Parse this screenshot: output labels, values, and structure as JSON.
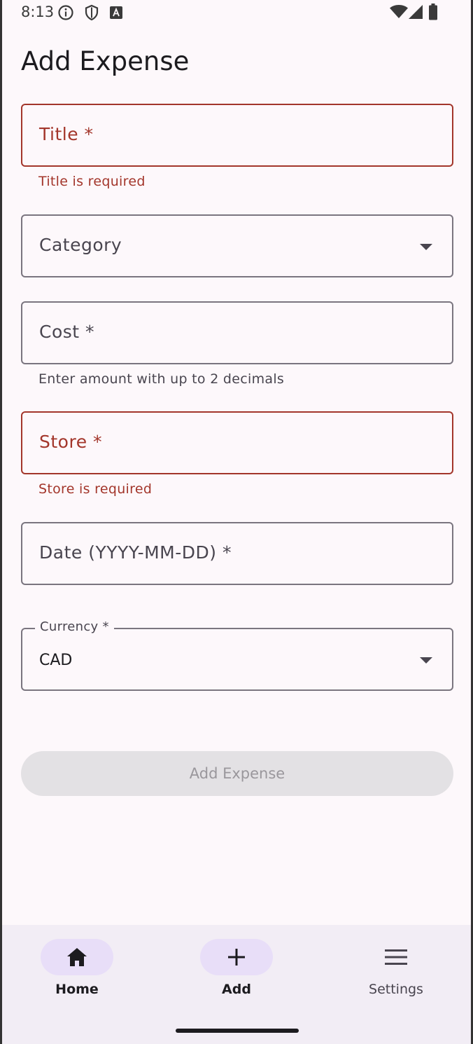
{
  "status_bar": {
    "time": "8:13",
    "left_icons": [
      "info-icon",
      "shield-icon",
      "font-a-icon"
    ],
    "right_icons": [
      "wifi-icon",
      "signal-icon",
      "battery-icon"
    ]
  },
  "page": {
    "title": "Add Expense"
  },
  "form": {
    "title_field": {
      "label": "Title *",
      "error": "Title is required"
    },
    "category_field": {
      "label": "Category"
    },
    "cost_field": {
      "label": "Cost *",
      "helper": "Enter amount with up to 2 decimals"
    },
    "store_field": {
      "label": "Store *",
      "error": "Store is required"
    },
    "date_field": {
      "label": "Date (YYYY-MM-DD) *"
    },
    "currency_field": {
      "label": "Currency *",
      "value": "CAD"
    },
    "submit_label": "Add Expense"
  },
  "bottom_nav": {
    "items": [
      {
        "label": "Home",
        "icon": "home-icon",
        "active": true
      },
      {
        "label": "Add",
        "icon": "plus-icon",
        "active": true
      },
      {
        "label": "Settings",
        "icon": "menu-icon",
        "active": false
      }
    ]
  },
  "colors": {
    "background": "#fdf8fb",
    "error": "#a3362b",
    "outline": "#7a757f",
    "nav_background": "#f2edf5",
    "nav_indicator": "#e8def8"
  }
}
